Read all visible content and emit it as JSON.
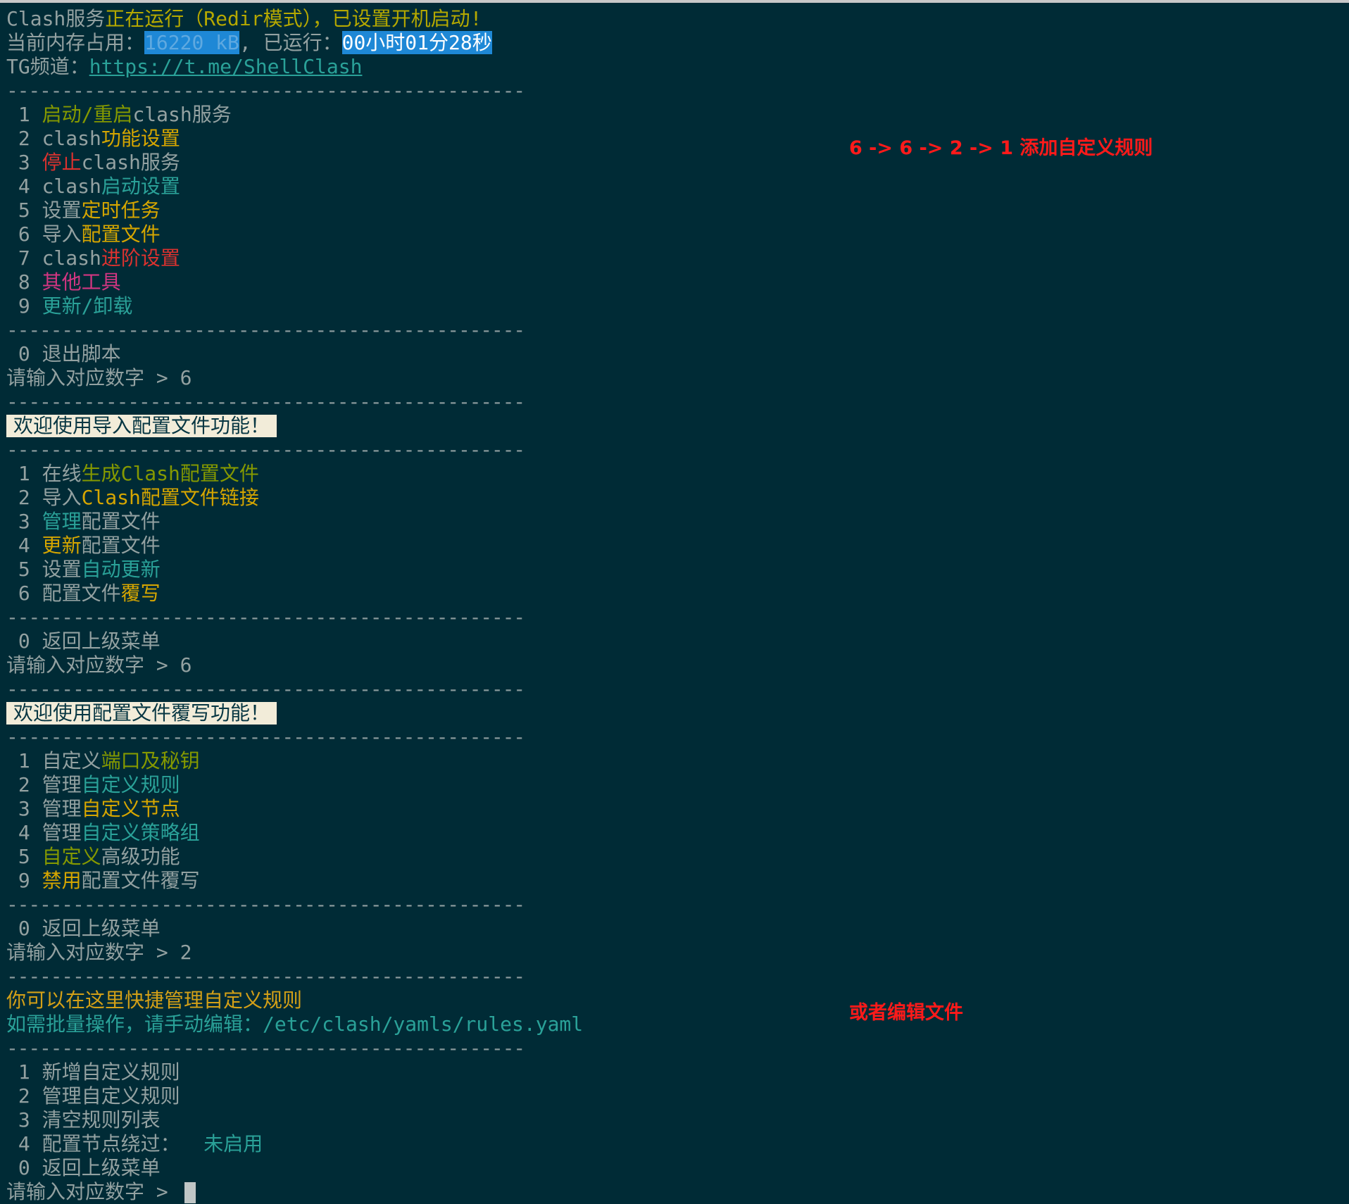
{
  "status": {
    "service_prefix": "Clash服务",
    "service_state": "正在运行（Redir模式），已设置开机启动!",
    "memory_label": "当前内存占用：",
    "memory_value": "16220 kB",
    "uptime_label": ", 已运行：",
    "uptime_value": "00小时01分28秒",
    "tg_label": "TG频道：",
    "tg_link": "https://t.me/ShellClash"
  },
  "separator": "-----------------------------------------------",
  "main_menu": {
    "items": [
      {
        "num": " 1 ",
        "a": "启动/重启",
        "b": "clash服务"
      },
      {
        "num": " 2 ",
        "a": "clash",
        "b": "功能设置"
      },
      {
        "num": " 3 ",
        "a": "停止",
        "b": "clash服务"
      },
      {
        "num": " 4 ",
        "a": "clash",
        "b": "启动设置"
      },
      {
        "num": " 5 ",
        "a": "设置",
        "b": "定时任务"
      },
      {
        "num": " 6 ",
        "a": "导入",
        "b": "配置文件"
      },
      {
        "num": " 7 ",
        "a": "clash",
        "b": "进阶设置"
      },
      {
        "num": " 8 ",
        "a": "其他工具",
        "b": ""
      },
      {
        "num": " 9 ",
        "a": "更新/卸载",
        "b": ""
      }
    ],
    "exit": " 0 退出脚本",
    "prompt": "请输入对应数字 > 6"
  },
  "import_menu": {
    "banner": "欢迎使用导入配置文件功能！",
    "items": [
      {
        "num": " 1 ",
        "a": "在线",
        "b": "生成Clash配置文件"
      },
      {
        "num": " 2 ",
        "a": "导入",
        "b": "Clash配置文件链接"
      },
      {
        "num": " 3 ",
        "a": "管理",
        "b": "配置文件"
      },
      {
        "num": " 4 ",
        "a": "更新",
        "b": "配置文件"
      },
      {
        "num": " 5 ",
        "a": "设置",
        "b": "自动更新"
      },
      {
        "num": " 6 ",
        "a": "配置文件",
        "b": "覆写"
      }
    ],
    "back": " 0 返回上级菜单",
    "prompt": "请输入对应数字 > 6"
  },
  "override_menu": {
    "banner": "欢迎使用配置文件覆写功能！",
    "items": [
      {
        "num": " 1 ",
        "a": "自定义",
        "b": "端口及秘钥"
      },
      {
        "num": " 2 ",
        "a": "管理",
        "b": "自定义规则"
      },
      {
        "num": " 3 ",
        "a": "管理",
        "b": "自定义节点"
      },
      {
        "num": " 4 ",
        "a": "管理",
        "b": "自定义策略组"
      },
      {
        "num": " 5 ",
        "a": "自定义",
        "b": "高级功能"
      },
      {
        "num": " 9 ",
        "a": "禁用",
        "b": "配置文件覆写"
      }
    ],
    "back": " 0 返回上级菜单",
    "prompt": "请输入对应数字 > 2"
  },
  "rules_menu": {
    "hint1": "你可以在这里快捷管理自定义规则",
    "hint2": "如需批量操作，请手动编辑：/etc/clash/yamls/rules.yaml",
    "items": [
      {
        "num": " 1 ",
        "a": "新增自定义规则",
        "b": ""
      },
      {
        "num": " 2 ",
        "a": "管理自定义规则",
        "b": ""
      },
      {
        "num": " 3 ",
        "a": "清空规则列表",
        "b": ""
      },
      {
        "num": " 4 ",
        "a": "配置节点绕过：",
        "b": "  未启用"
      }
    ],
    "back": " 0 返回上级菜单",
    "prompt": "请输入对应数字 > "
  },
  "annotations": {
    "steps": "6 -> 6 -> 2 -> 1 添加自定义规则",
    "alt": "或者编辑文件"
  },
  "colors": {
    "background": "#002b36",
    "annotation": "#ff1a1a",
    "selection": "#1e88d6"
  }
}
